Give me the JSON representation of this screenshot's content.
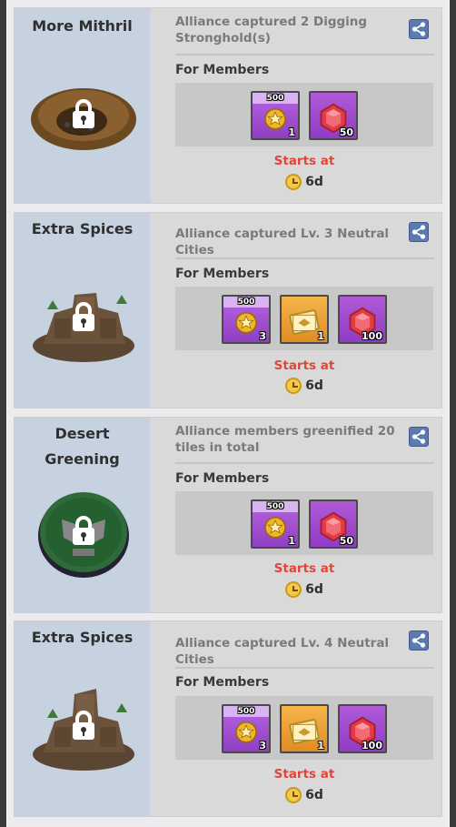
{
  "cards": [
    {
      "title_lines": [
        "More Mithril"
      ],
      "description": "Alliance captured 2 Digging Stronghold(s)",
      "for_members": "For Members",
      "rewards": [
        {
          "icon": "medal-500-icon",
          "top": "500",
          "qty": "1",
          "color": "purple"
        },
        {
          "icon": "ruby-gem-icon",
          "qty": "50",
          "color": "ruby"
        }
      ],
      "starts_label": "Starts at",
      "timer": "6d",
      "illustration": "mithril-mine-icon"
    },
    {
      "title_lines": [
        "Extra Spices"
      ],
      "description": "Alliance captured Lv. 3 Neutral Cities",
      "for_members": "For Members",
      "rewards": [
        {
          "icon": "medal-500-icon",
          "top": "500",
          "qty": "3",
          "color": "purple"
        },
        {
          "icon": "ticket-icon",
          "qty": "1",
          "color": "orange"
        },
        {
          "icon": "ruby-gem-icon",
          "qty": "100",
          "color": "ruby"
        }
      ],
      "starts_label": "Starts at",
      "timer": "6d",
      "illustration": "desert-city-icon"
    },
    {
      "title_lines": [
        "Desert",
        "Greening"
      ],
      "description": "Alliance members greenified 20 tiles in total",
      "for_members": "For Members",
      "rewards": [
        {
          "icon": "medal-500-icon",
          "top": "500",
          "qty": "1",
          "color": "purple"
        },
        {
          "icon": "ruby-gem-icon",
          "qty": "50",
          "color": "ruby"
        }
      ],
      "starts_label": "Starts at",
      "timer": "6d",
      "illustration": "greening-badge-icon"
    },
    {
      "title_lines": [
        "Extra Spices"
      ],
      "description": "Alliance captured Lv. 4 Neutral Cities",
      "for_members": "For Members",
      "rewards": [
        {
          "icon": "medal-500-icon",
          "top": "500",
          "qty": "3",
          "color": "purple"
        },
        {
          "icon": "ticket-icon",
          "qty": "1",
          "color": "orange"
        },
        {
          "icon": "ruby-gem-icon",
          "qty": "100",
          "color": "ruby"
        }
      ],
      "starts_label": "Starts at",
      "timer": "6d",
      "illustration": "desert-tower-icon"
    }
  ],
  "colors": {
    "left_panel": "#c7d2e1",
    "starts_text": "#e0453a",
    "share_button": "#5d7ab0",
    "medal_purple": "#a24fd2",
    "ticket_orange": "#f0a53a",
    "ruby_bg": "#e03a4a"
  }
}
